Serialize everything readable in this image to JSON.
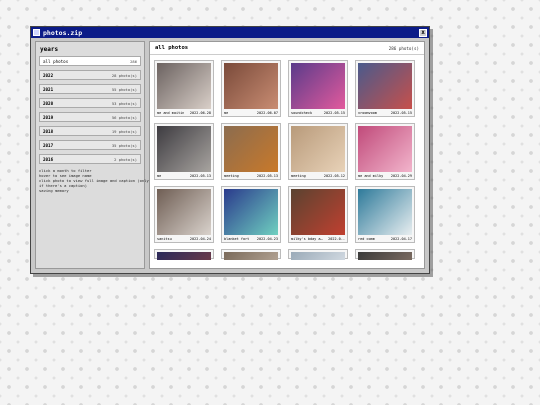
{
  "window": {
    "title": "photos.zip",
    "close_label": "x"
  },
  "sidebar": {
    "title": "years",
    "months": [
      {
        "label": "all photos",
        "count": "286"
      }
    ],
    "years": [
      {
        "label": "2022",
        "count": "28 photo(s)"
      },
      {
        "label": "2021",
        "count": "55 photo(s)"
      },
      {
        "label": "2020",
        "count": "53 photo(s)"
      },
      {
        "label": "2019",
        "count": "56 photo(s)"
      },
      {
        "label": "2018",
        "count": "19 photo(s)"
      },
      {
        "label": "2017",
        "count": "35 photo(s)"
      },
      {
        "label": "2016",
        "count": "2 photo(s)"
      }
    ],
    "help": [
      "click a month to filter",
      "hover to see image name",
      "click photo to view full image and caption (only",
      "if there's a caption)",
      "saving memory"
    ]
  },
  "main": {
    "title": "all photos",
    "count": "286 photo(s)",
    "photos": [
      {
        "name": "me and maitin",
        "date": "2022-06-28",
        "colors": [
          "#6b6260",
          "#d9cfc8"
        ]
      },
      {
        "name": "me",
        "date": "2022-06-07",
        "colors": [
          "#7a4a3a",
          "#c98d73"
        ]
      },
      {
        "name": "soundcheck",
        "date": "2022-05-15",
        "colors": [
          "#5a3b8a",
          "#e25a9d"
        ]
      },
      {
        "name": "vroomvoom",
        "date": "2022-05-15",
        "colors": [
          "#4a5a8c",
          "#c7504b"
        ]
      },
      {
        "name": "me",
        "date": "2022-05-13",
        "colors": [
          "#3d3b40",
          "#a8a4a0"
        ]
      },
      {
        "name": "meeting",
        "date": "2022-05-13",
        "colors": [
          "#8b6c4f",
          "#c9792a"
        ]
      },
      {
        "name": "meeting",
        "date": "2022-05-12",
        "colors": [
          "#b89a7a",
          "#e8d2b8"
        ]
      },
      {
        "name": "me and milky",
        "date": "2022-04-29",
        "colors": [
          "#c04a7a",
          "#f2b5cc"
        ]
      },
      {
        "name": "sanitsu",
        "date": "2022-04-24",
        "colors": [
          "#6f5e54",
          "#d9d2cc"
        ]
      },
      {
        "name": "blanket fort",
        "date": "2022-04-23",
        "colors": [
          "#2a3a8c",
          "#6fd0c0"
        ]
      },
      {
        "name": "milky's bday arr--",
        "date": "2022-0--",
        "colors": [
          "#5a4330",
          "#c04030"
        ]
      },
      {
        "name": "red comm",
        "date": "2022-04-17",
        "colors": [
          "#2e7a9a",
          "#e8eef0"
        ]
      },
      {
        "name": "",
        "date": "",
        "colors": [
          "#2a2a5a",
          "#6a3a4a"
        ]
      },
      {
        "name": "",
        "date": "",
        "colors": [
          "#7a6a5a",
          "#b0a090"
        ]
      },
      {
        "name": "",
        "date": "",
        "colors": [
          "#9aaab8",
          "#d0d8e0"
        ]
      },
      {
        "name": "",
        "date": "",
        "colors": [
          "#3a3a3a",
          "#7a6a60"
        ]
      }
    ]
  },
  "colors": {
    "titlebar": "#0c1c88",
    "window_bg": "#c8c8c8"
  }
}
